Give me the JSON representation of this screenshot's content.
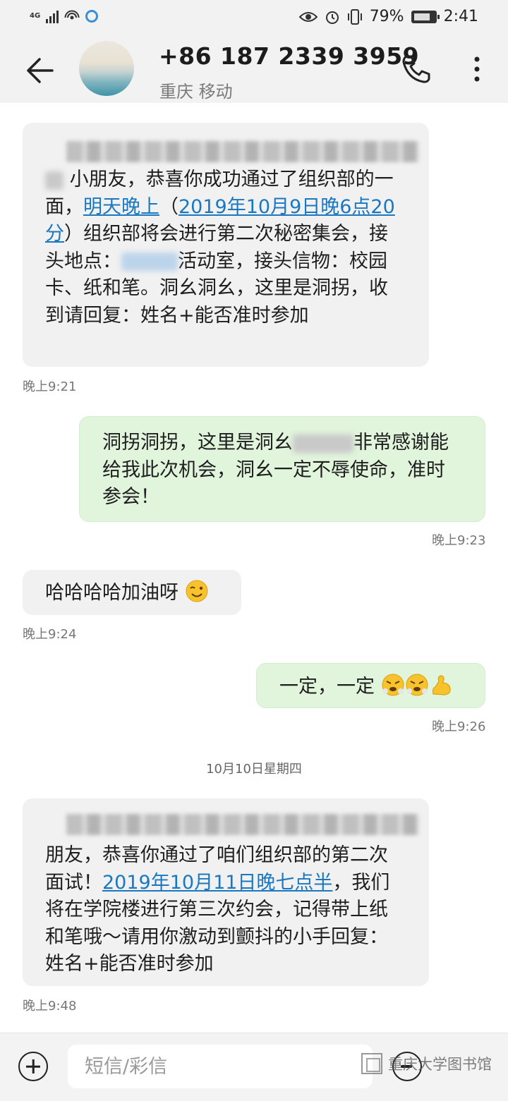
{
  "status_bar": {
    "network": "4G",
    "battery": "79%",
    "time": "2:41"
  },
  "header": {
    "contact_number": "+86 187 2339 3959",
    "contact_location": "重庆 移动"
  },
  "messages": [
    {
      "direction": "incoming",
      "text_parts": [
        "小朋友，恭喜你成功通过了组织部的一面，",
        "明天晚上",
        "（",
        "2019年10月9日晚6点20分",
        "）组织部将会进行第二次秘密集会，接头地点：",
        "活动室，接头信物：校园卡、纸和笔。洞幺洞幺，这里是洞拐，收到请回复：姓名+能否准时参加"
      ],
      "time": "晚上9:21"
    },
    {
      "direction": "outgoing",
      "text_parts": [
        "洞拐洞拐，这里是洞幺",
        "非常感谢能给我此次机会，洞幺一定不辱使命，准时参会！"
      ],
      "time": "晚上9:23"
    },
    {
      "direction": "incoming",
      "text": "哈哈哈哈加油呀",
      "emoji": "wink-emoji",
      "time": "晚上9:24"
    },
    {
      "direction": "outgoing",
      "text": "一定，一定",
      "emojis": [
        "triumph-emoji",
        "triumph-emoji",
        "flexed-biceps-emoji"
      ],
      "time": "晚上9:26"
    },
    {
      "direction": "incoming",
      "text_parts": [
        "朋友，恭喜你通过了咱们组织部的第二次面试！",
        "2019年10月11日晚七点半",
        "，我们将在学院楼进行第三次约会，记得带上纸和笔哦～请用你激动到颤抖的小手回复：姓名+能否准时参加"
      ],
      "time": "晚上9:48"
    }
  ],
  "date_separator": "10月10日星期四",
  "input_bar": {
    "placeholder": "短信/彩信",
    "watermark": "重庆大学图书馆"
  },
  "colors": {
    "incoming_bubble": "#f1f1f1",
    "outgoing_bubble": "#e1f4dc",
    "link": "#1a78c2",
    "header_bg": "#f2f2f2"
  }
}
